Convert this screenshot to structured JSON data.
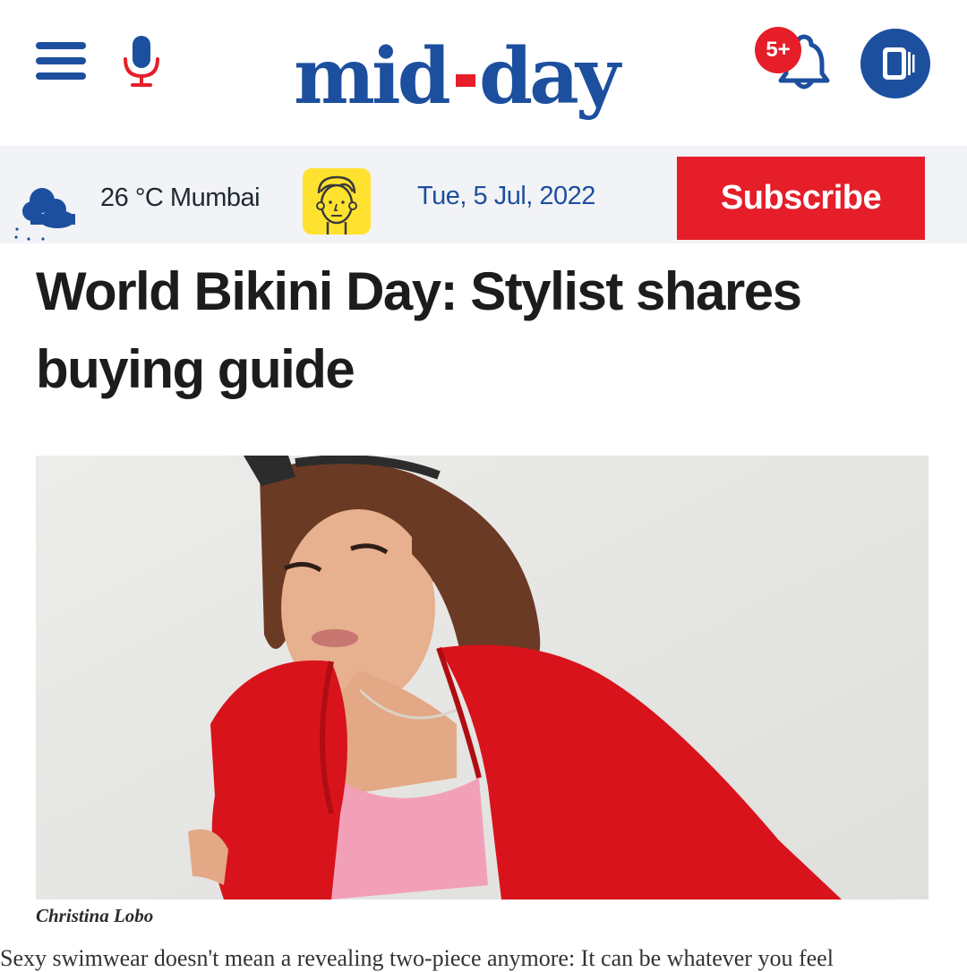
{
  "header": {
    "logo_text": "mid-day",
    "notification_badge": "5+",
    "icons": {
      "menu": "hamburger-menu-icon",
      "mic": "microphone-icon",
      "bell": "bell-icon",
      "app": "app-icon"
    },
    "colors": {
      "brand_blue": "#1d4f9f",
      "brand_red": "#e51e2a"
    }
  },
  "info_strip": {
    "temperature": "26 °C Mumbai",
    "weather_icon": "cloudy-weather-icon",
    "avatar_icon": "cartoon-avatar-icon",
    "date": "Tue, 5 Jul, 2022",
    "subscribe_label": "Subscribe"
  },
  "article": {
    "headline": "World Bikini Day: Stylist shares buying guide",
    "photo_caption": "Christina Lobo",
    "body_start": "Sexy swimwear doesn't mean a revealing two-piece anymore: It can be whatever you feel"
  }
}
